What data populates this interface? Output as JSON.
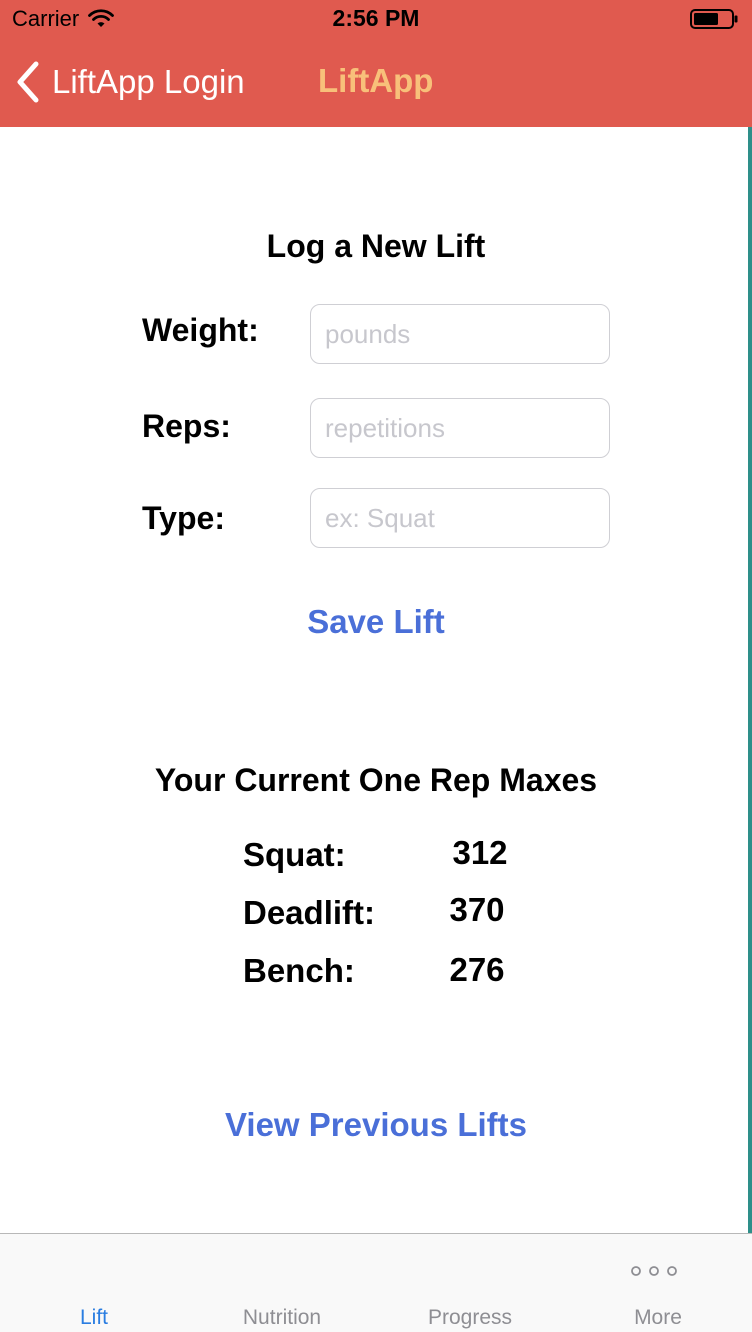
{
  "status_bar": {
    "carrier": "Carrier",
    "time": "2:56 PM"
  },
  "nav_bar": {
    "back_label": "LiftApp Login",
    "title": "LiftApp",
    "title_color": "#f8c07a",
    "background_color": "#e05a4f"
  },
  "log_section": {
    "title": "Log a New Lift",
    "fields": [
      {
        "label": "Weight:",
        "value": "",
        "placeholder": "pounds"
      },
      {
        "label": "Reps:",
        "value": "",
        "placeholder": "repetitions"
      },
      {
        "label": "Type:",
        "value": "",
        "placeholder": "ex: Squat"
      }
    ],
    "save_label": "Save Lift"
  },
  "maxes_section": {
    "title": "Your Current One Rep Maxes",
    "rows": [
      {
        "label": "Squat:",
        "value": "312"
      },
      {
        "label": "Deadlift:",
        "value": "370"
      },
      {
        "label": "Bench:",
        "value": "276"
      }
    ]
  },
  "view_previous_label": "View Previous Lifts",
  "accent_color": "#4a6fd8",
  "tab_bar": {
    "tabs": [
      {
        "label": "Lift",
        "active": true
      },
      {
        "label": "Nutrition",
        "active": false
      },
      {
        "label": "Progress",
        "active": false
      },
      {
        "label": "More",
        "active": false,
        "icon": "more-dots-icon"
      }
    ]
  }
}
